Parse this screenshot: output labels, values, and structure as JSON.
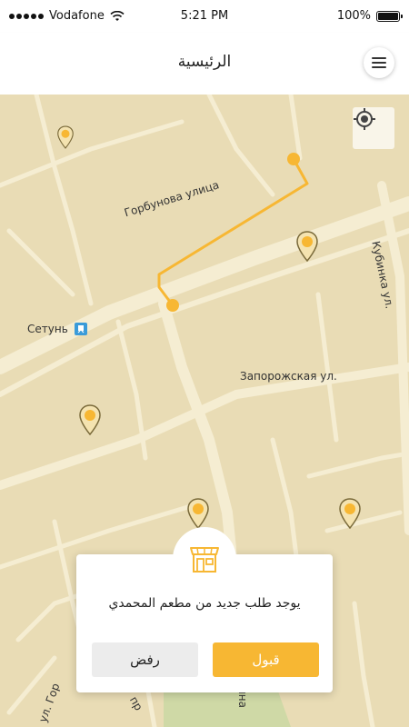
{
  "status_bar": {
    "carrier": "Vodafone",
    "time": "5:21 PM",
    "battery": "100%"
  },
  "header": {
    "title": "الرئيسية"
  },
  "map": {
    "street_labels": [
      "Горбунова улица",
      "Сетунь",
      "Запорожская ул.",
      "Кубинка ул.",
      "ул. Гор",
      "пр",
      "ина"
    ]
  },
  "order": {
    "message": "يوجد طلب جديد من مطعم المحمدي",
    "reject_label": "رفض",
    "accept_label": "قبول"
  },
  "colors": {
    "accent": "#f7b733",
    "map_background": "#e9dcb5",
    "route": "#f7b733"
  }
}
